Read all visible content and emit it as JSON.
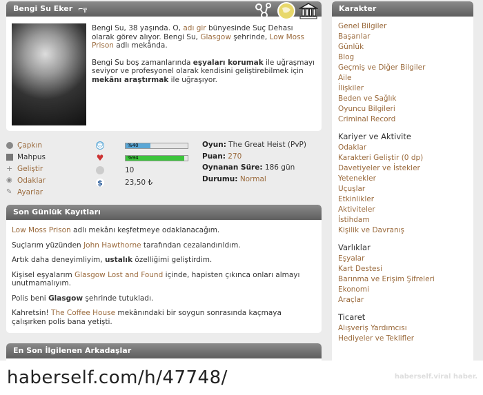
{
  "profile": {
    "name": "Bengi Su Eker",
    "bio": {
      "p1_pre": "Bengi Su, 38 yaşında. O, ",
      "p1_link1": "adı gir",
      "p1_mid1": " bünyesinde Suç Dehası olarak görev alıyor. Bengi Su, ",
      "p1_link2": "Glasgow",
      "p1_mid2": " şehrinde, ",
      "p1_link3": "Low Moss Prison",
      "p1_post": " adlı mekânda.",
      "p2_pre": "Bengi Su boş zamanlarında ",
      "p2_bold1": "eşyaları korumak",
      "p2_mid": " ile uğraşmayı seviyor ve profesyonel olarak kendisini geliştirebilmek için ",
      "p2_bold2": "mekânı araştırmak",
      "p2_post": " ile uğraşıyor."
    }
  },
  "actions": [
    "Çapkın",
    "Mahpus",
    "Geliştir",
    "Odaklar",
    "Ayarlar"
  ],
  "stats": {
    "mood_label": "%40",
    "mood_value": 0.4,
    "health_label": "%94",
    "health_value": 0.94,
    "level": "10",
    "money": "23,50 ₺"
  },
  "game": {
    "game_label": "Oyun:",
    "game_value": "The Great Heist (PvP)",
    "points_label": "Puan:",
    "points_value": "270",
    "played_label": "Oynanan Süre:",
    "played_value": "186 gün",
    "status_label": "Durumu:",
    "status_value": "Normal"
  },
  "logs": {
    "title": "Son Günlük Kayıtları",
    "e1_link": "Low Moss Prison",
    "e1_post": " adlı mekânı keşfetmeye odaklanacağım.",
    "e2_pre": "Suçlarım yüzünden ",
    "e2_link": "John Hawthorne",
    "e2_post": " tarafından cezalandırıldım.",
    "e3_pre": "Artık daha deneyimliyim, ",
    "e3_bold": "ustalık",
    "e3_post": " özelliğimi geliştirdim.",
    "e4_pre": "Kişisel eşyalarım ",
    "e4_link": "Glasgow Lost and Found",
    "e4_post": " içinde, hapisten çıkınca onları almayı unutmamalıyım.",
    "e5_pre": "Polis beni ",
    "e5_bold": "Glasgow",
    "e5_post": " şehrinde tutukladı.",
    "e6_pre": "Kahretsin! ",
    "e6_link": "The Coffee House",
    "e6_post": " mekânındaki bir soygun sonrasında kaçmaya çalışırken polis bana yetişti."
  },
  "friends": {
    "title": "En Son İlgilenen Arkadaşlar"
  },
  "sidebar": {
    "title": "Karakter",
    "group1": [
      "Genel Bilgiler",
      "Başarılar",
      "Günlük",
      "Blog",
      "Geçmiş ve Diğer Bilgiler",
      "Aile",
      "İlişkiler",
      "Beden ve Sağlık",
      "Oyuncu Bilgileri",
      "Criminal Record"
    ],
    "section2": "Kariyer ve Aktivite",
    "group2": [
      "Odaklar",
      "Karakteri Geliştir (0 dp)",
      "Davetiyeler ve İstekler",
      "Yetenekler",
      "Uçuşlar",
      "Etkinlikler",
      "Aktiviteler",
      "İstihdam",
      "Kişilik ve Davranış"
    ],
    "section3": "Varlıklar",
    "group3": [
      "Eşyalar",
      "Kart Destesi",
      "Barınma ve Erişim Şifreleri",
      "Ekonomi",
      "Araçlar"
    ],
    "section4": "Ticaret",
    "group4": [
      "Alışveriş Yardımcısı",
      "Hediyeler ve Teklifler"
    ]
  },
  "footer": {
    "url": "haberself.com/h/47748/",
    "watermark": "haberself.viral haber."
  },
  "colors": {
    "link": "#9a6a3c",
    "mood_bar": "#5aa7d6",
    "health_bar": "#3cc43c",
    "header": "#6e6e6e"
  }
}
